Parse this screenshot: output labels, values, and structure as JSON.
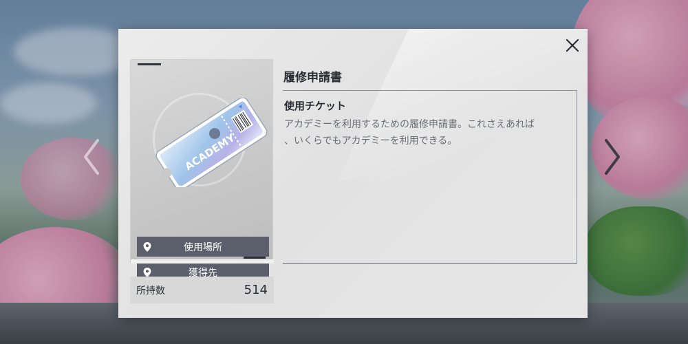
{
  "dialog": {
    "item_name": "履修申請書",
    "item_type": "使用チケット",
    "description_line1": "アカデミーを利用するための履修申請書。これさえあれば",
    "description_line2": "、いくらでもアカデミーを利用できる。",
    "ticket_text": "ACADEMY",
    "buttons": {
      "usage_location": "使用場所",
      "acquisition": "獲得先"
    },
    "owned": {
      "label": "所持数",
      "value": "514"
    },
    "icons": {
      "close": "close-icon",
      "pin": "location-pin-icon",
      "prev": "chevron-left-icon",
      "next": "chevron-right-icon"
    }
  },
  "colors": {
    "panel": "#e6e6e6",
    "card_button": "#5b5f6b",
    "text_dark": "#2a2d34",
    "text_muted": "#6a6d74"
  }
}
